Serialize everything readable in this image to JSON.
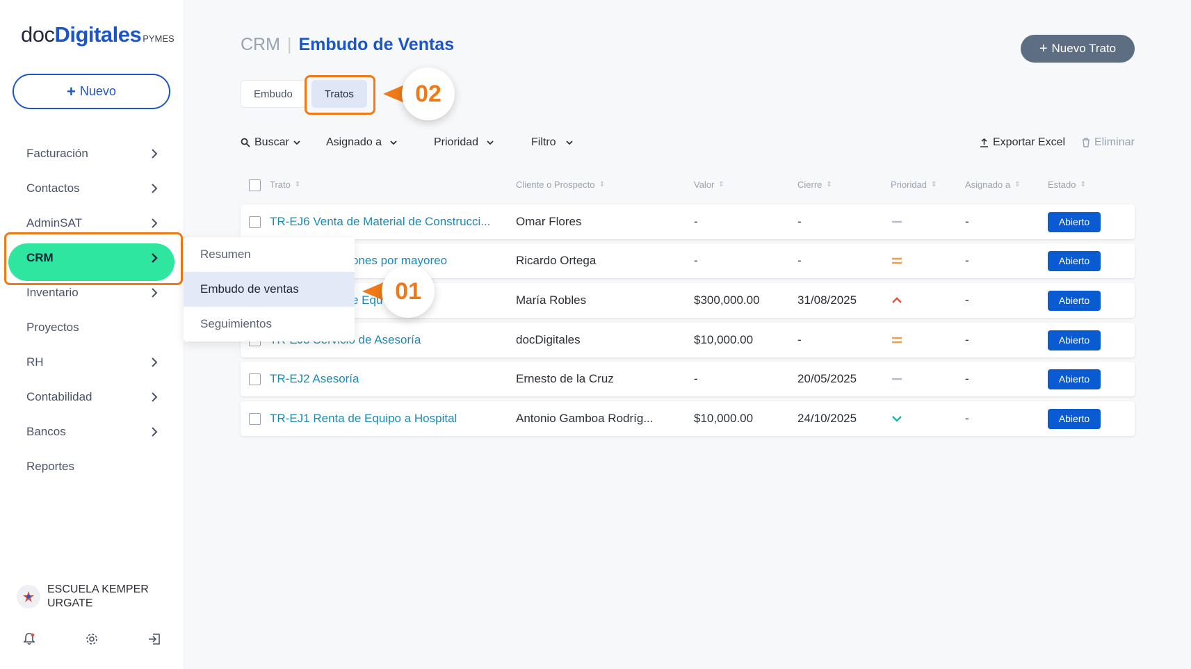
{
  "app": {
    "logo": {
      "doc": "doc",
      "digitales": "Digitales",
      "pymes": "PYMES"
    },
    "new_button": "Nuevo",
    "new_button_icon": "plus-icon"
  },
  "sidebar": {
    "items": [
      {
        "label": "Facturación",
        "has_chevron": true
      },
      {
        "label": "Contactos",
        "has_chevron": true
      },
      {
        "label": "AdminSAT",
        "has_chevron": true
      },
      {
        "label": "CRM",
        "has_chevron": true,
        "active": true
      },
      {
        "label": "Inventario",
        "has_chevron": true
      },
      {
        "label": "Proyectos",
        "has_chevron": false
      },
      {
        "label": "RH",
        "has_chevron": true
      },
      {
        "label": "Contabilidad",
        "has_chevron": true
      },
      {
        "label": "Bancos",
        "has_chevron": true
      },
      {
        "label": "Reportes",
        "has_chevron": false
      }
    ],
    "user": {
      "name": "ESCUELA KEMPER URGATE"
    },
    "bottom_icons": [
      "bell-icon",
      "gear-icon",
      "logout-icon"
    ]
  },
  "submenu": {
    "items": [
      {
        "label": "Resumen"
      },
      {
        "label": "Embudo de ventas",
        "selected": true
      },
      {
        "label": "Seguimientos"
      }
    ]
  },
  "header": {
    "section": "CRM",
    "separator": "|",
    "page_title": "Embudo de Ventas",
    "new_deal_button": "Nuevo Trato"
  },
  "tabs": [
    {
      "label": "Embudo"
    },
    {
      "label": "Tratos",
      "selected": true
    }
  ],
  "callouts": {
    "c1": "01",
    "c2": "02",
    "accent_color": "#f07a17"
  },
  "toolbar": {
    "search": "Buscar",
    "assigned": "Asignado a",
    "priority": "Prioridad",
    "filter": "Filtro",
    "export": "Exportar Excel",
    "delete": "Eliminar"
  },
  "table": {
    "columns": [
      "Trato",
      "Cliente o Prospecto",
      "Valor",
      "Cierre",
      "Prioridad",
      "Asignado a",
      "Estado"
    ],
    "rows": [
      {
        "deal": "TR-EJ6 Venta de Material de Construcci...",
        "client": "Omar Flores",
        "value": "-",
        "close": "-",
        "priority": "none",
        "assigned": "-",
        "status": "Abierto"
      },
      {
        "deal": "ones por mayoreo",
        "client": "Ricardo Ortega",
        "value": "-",
        "close": "-",
        "priority": "medium",
        "assigned": "-",
        "status": "Abierto"
      },
      {
        "deal": "e Equ",
        "client": "María Robles",
        "value": "$300,000.00",
        "close": "31/08/2025",
        "priority": "high",
        "assigned": "-",
        "status": "Abierto"
      },
      {
        "deal": "TR-EJ3 Servicio de Asesoría",
        "client": "docDigitales",
        "value": "$10,000.00",
        "close": "-",
        "priority": "medium",
        "assigned": "-",
        "status": "Abierto"
      },
      {
        "deal": "TR-EJ2 Asesoría",
        "client": "Ernesto de la Cruz",
        "value": "-",
        "close": "20/05/2025",
        "priority": "none",
        "assigned": "-",
        "status": "Abierto"
      },
      {
        "deal": "TR-EJ1 Renta de Equipo a Hospital",
        "client": "Antonio Gamboa Rodríg...",
        "value": "$10,000.00",
        "close": "24/10/2025",
        "priority": "low",
        "assigned": "-",
        "status": "Abierto"
      }
    ]
  },
  "colors": {
    "brand": "#1a56c9",
    "active_nav": "#2ee6a0",
    "badge": "#0a5ad1",
    "link": "#1a8ab8"
  }
}
